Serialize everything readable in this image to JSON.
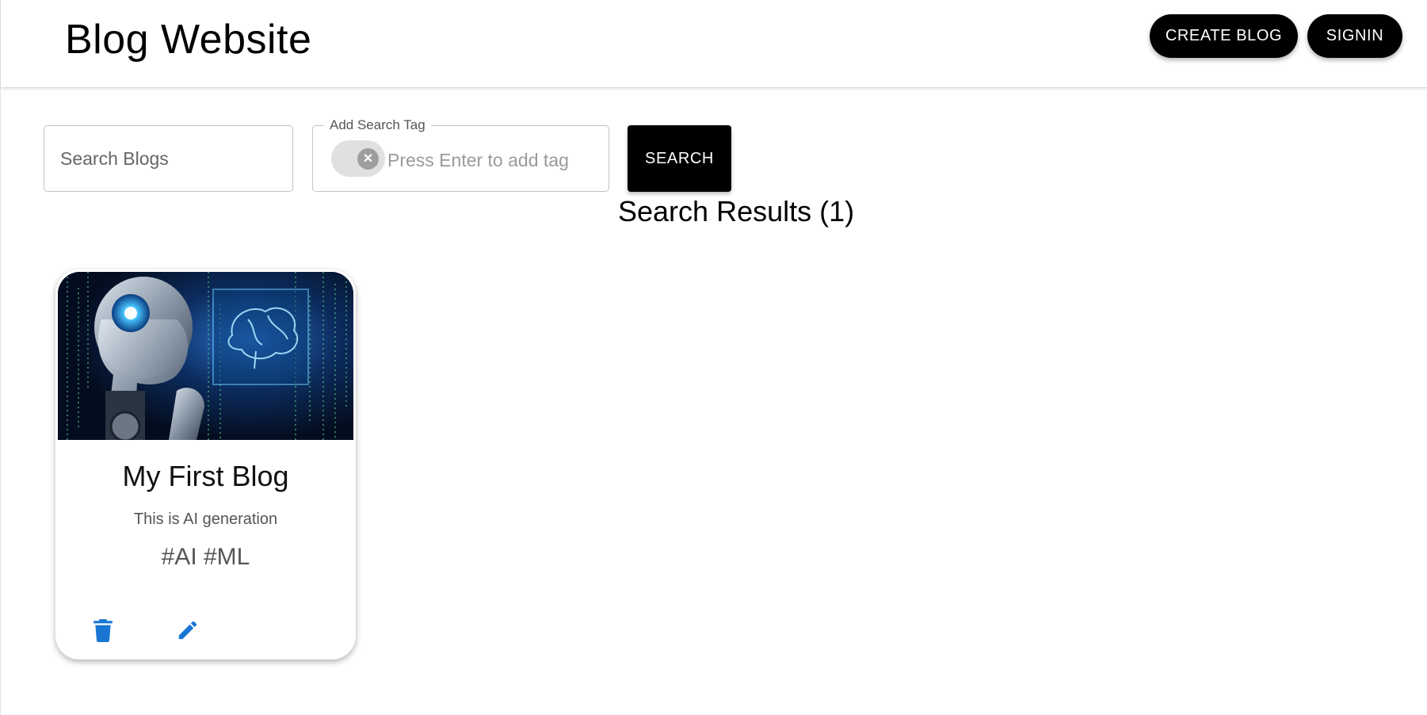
{
  "header": {
    "title": "Blog Website",
    "create_label": "CREATE BLOG",
    "signin_label": "SIGNIN"
  },
  "search": {
    "placeholder": "Search Blogs",
    "value": ""
  },
  "tag_search": {
    "label": "Add Search Tag",
    "placeholder": "Press Enter to add tag",
    "value": ""
  },
  "search_button_label": "SEARCH",
  "results_heading": "Search Results (1)",
  "blogs": [
    {
      "title": "My First Blog",
      "description": "This is AI generation",
      "tags": "#AI #ML",
      "image_icon": "ai-robot-brain-image"
    }
  ],
  "icons": {
    "delete": "trash-icon",
    "edit": "pencil-icon",
    "chip_delete": "close-circle-icon"
  },
  "colors": {
    "primary_button": "#000000",
    "action_icon": "#1976d2"
  }
}
